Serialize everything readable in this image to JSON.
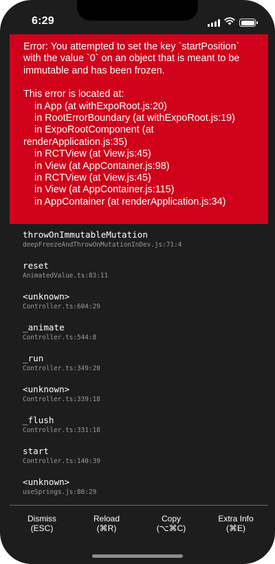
{
  "status_bar": {
    "time": "6:29",
    "signal_icon": "cellular-signal-icon",
    "wifi_icon": "wifi-icon",
    "battery_icon": "battery-icon",
    "battery_level": 1.0
  },
  "error": {
    "background_color": "#d0021b",
    "message": "Error: You attempted to set the key `startPosition` with the value `0` on an object that is meant to be immutable and has been frozen.",
    "location_title": "This error is located at:",
    "locations": [
      "    in App (at withExpoRoot.js:20)",
      "    in RootErrorBoundary (at withExpoRoot.js:19)",
      "    in ExpoRootComponent (at renderApplication.js:35)",
      "    in RCTView (at View.js:45)",
      "    in View (at AppContainer.js:98)",
      "    in RCTView (at View.js:45)",
      "    in View (at AppContainer.js:115)",
      "    in AppContainer (at renderApplication.js:34)"
    ]
  },
  "stack_frames": [
    {
      "method": "throwOnImmutableMutation",
      "file": "deepFreezeAndThrowOnMutationInDev.js:71:4"
    },
    {
      "method": "reset",
      "file": "AnimatedValue.ts:83:11"
    },
    {
      "method": "<unknown>",
      "file": "Controller.ts:604:29"
    },
    {
      "method": "_animate",
      "file": "Controller.ts:544:8"
    },
    {
      "method": "_run",
      "file": "Controller.ts:349:20"
    },
    {
      "method": "<unknown>",
      "file": "Controller.ts:339:18"
    },
    {
      "method": "_flush",
      "file": "Controller.ts:331:18"
    },
    {
      "method": "start",
      "file": "Controller.ts:140:39"
    },
    {
      "method": "<unknown>",
      "file": "useSprings.js:80:29"
    }
  ],
  "toolbar": {
    "dismiss": {
      "label": "Dismiss",
      "shortcut": "(ESC)"
    },
    "reload": {
      "label": "Reload",
      "shortcut": "(⌘R)"
    },
    "copy": {
      "label": "Copy",
      "shortcut": "(⌥⌘C)"
    },
    "extra_info": {
      "label": "Extra Info",
      "shortcut": "(⌘E)"
    }
  }
}
